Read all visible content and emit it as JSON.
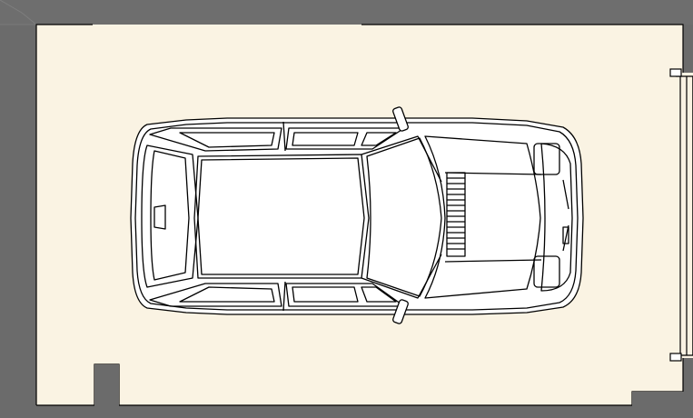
{
  "drawing": {
    "subject": "garage-floor-plan-with-car-top-view",
    "colors": {
      "wall": "#6b6b6b",
      "floor": "#faf3e3",
      "line": "#000000",
      "car_fill": "#ffffff"
    }
  }
}
